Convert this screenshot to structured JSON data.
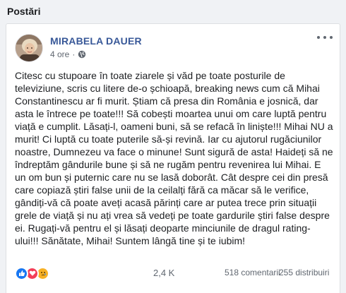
{
  "section": {
    "title": "Postări"
  },
  "post": {
    "author": "MIRABELA DAUER",
    "time": "4 ore",
    "separator": "·",
    "privacy_icon": "globe-icon",
    "more_icon": "more-options-icon",
    "text": "Citesc cu stupoare în toate ziarele și văd pe toate posturile de televiziune, scris cu litere de-o șchioapă, breaking news cum că Mihai Constantinescu ar fi murit. Știam că presa din România e josnică, dar asta le întrece pe toate!!! Să cobești moartea unui om care luptă pentru viață e cumplit. Lăsați-l, oameni buni, să se refacă în liniște!!! Mihai NU a murit! Ci luptă cu toate puterile să-și revină. Iar cu ajutorul rugăciunilor noastre, Dumnezeu va face o minune! Sunt sigură de asta! Haideți să ne îndreptăm gândurile bune și să ne rugăm pentru revenirea lui Mihai. E un om bun și puternic care nu se lasă doborât. Cât despre cei din presă care copiază știri false unii de la ceilalți fără ca măcar să le verifice, gândiți-vă că poate aveți acasă părinți care ar putea trece prin situații grele de viață și nu ați vrea să vedeți pe toate gardurile știri false despre ei. Rugați-vă pentru el și lăsați deoparte minciunile de dragul rating-ului!!! Sănătate, Mihai! Suntem lângă tine și te iubim!"
  },
  "stats": {
    "reaction_icons": [
      "like-icon",
      "love-icon",
      "sad-icon"
    ],
    "reactions": "2,4 K",
    "comments": "518 comentarii",
    "shares": "255 distribuiri"
  },
  "colors": {
    "author_link": "#385898",
    "like": "#1877f2",
    "love": "#f33e58",
    "sad": "#f7b125",
    "background": "#f0f2f5"
  }
}
